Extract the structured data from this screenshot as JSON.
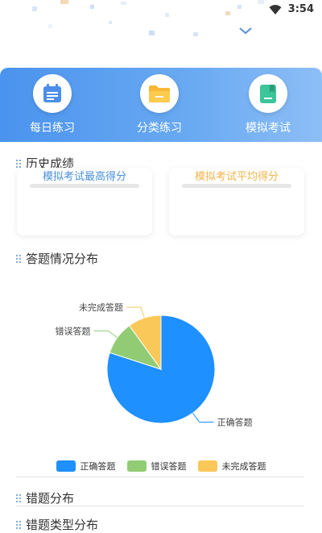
{
  "status": {
    "time": "3:54"
  },
  "quick_actions": [
    {
      "label": "每日练习",
      "icon": "calendar-icon"
    },
    {
      "label": "分类练习",
      "icon": "folder-icon"
    },
    {
      "label": "模拟考试",
      "icon": "book-icon"
    }
  ],
  "history": {
    "title": "历史成绩",
    "cards": [
      {
        "title": "模拟考试最高得分",
        "color": "#4a90d9"
      },
      {
        "title": "模拟考试平均得分",
        "color": "#f0b44c"
      }
    ]
  },
  "distribution": {
    "title": "答题情况分布"
  },
  "chart_data": {
    "type": "pie",
    "slices": [
      {
        "name": "正确答题",
        "value": 80,
        "color": "#1e90ff"
      },
      {
        "name": "错误答题",
        "value": 10,
        "color": "#91cc75"
      },
      {
        "name": "未完成答题",
        "value": 10,
        "color": "#fac858"
      }
    ],
    "legend_position": "bottom"
  },
  "sections": {
    "wrong_distribution": "错题分布",
    "wrong_type_distribution": "错题类型分布"
  }
}
